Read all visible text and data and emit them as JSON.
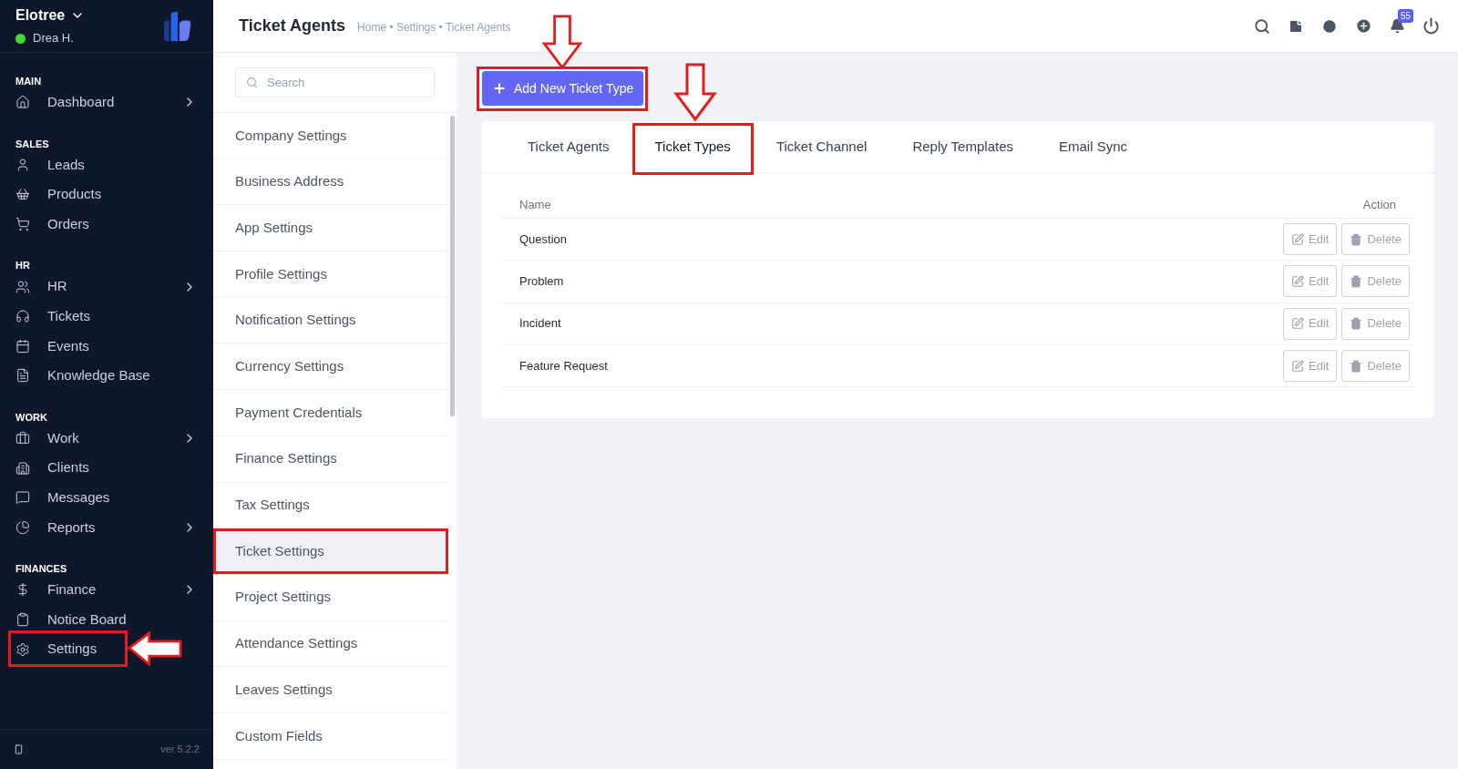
{
  "sidebar": {
    "workspace": "Elotree",
    "user": {
      "name": "Drea H.",
      "online": true
    },
    "sections": [
      {
        "title": "MAIN",
        "items": [
          {
            "label": "Dashboard",
            "expandable": true,
            "highlighted": false
          }
        ]
      },
      {
        "title": "SALES",
        "items": [
          {
            "label": "Leads",
            "expandable": false,
            "highlighted": false
          },
          {
            "label": "Products",
            "expandable": false,
            "highlighted": false
          },
          {
            "label": "Orders",
            "expandable": false,
            "highlighted": false
          }
        ]
      },
      {
        "title": "HR",
        "items": [
          {
            "label": "HR",
            "expandable": true,
            "highlighted": false
          },
          {
            "label": "Tickets",
            "expandable": false,
            "highlighted": false
          },
          {
            "label": "Events",
            "expandable": false,
            "highlighted": false
          },
          {
            "label": "Knowledge Base",
            "expandable": false,
            "highlighted": false
          }
        ]
      },
      {
        "title": "WORK",
        "items": [
          {
            "label": "Work",
            "expandable": true,
            "highlighted": false
          },
          {
            "label": "Clients",
            "expandable": false,
            "highlighted": false
          },
          {
            "label": "Messages",
            "expandable": false,
            "highlighted": false
          },
          {
            "label": "Reports",
            "expandable": true,
            "highlighted": false
          }
        ]
      },
      {
        "title": "FINANCES",
        "items": [
          {
            "label": "Finance",
            "expandable": true,
            "highlighted": false
          },
          {
            "label": "Notice Board",
            "expandable": false,
            "highlighted": false
          },
          {
            "label": "Settings",
            "expandable": false,
            "highlighted": true
          }
        ]
      }
    ],
    "version": "ver 5.2.2"
  },
  "header": {
    "title": "Ticket Agents",
    "breadcrumb": "Home • Settings • Ticket Agents",
    "notification_count": "55"
  },
  "settings_menu": {
    "search": {
      "placeholder": "Search"
    },
    "items": [
      {
        "label": "Company Settings",
        "selected": false,
        "highlighted": false
      },
      {
        "label": "Business Address",
        "selected": false,
        "highlighted": false
      },
      {
        "label": "App Settings",
        "selected": false,
        "highlighted": false
      },
      {
        "label": "Profile Settings",
        "selected": false,
        "highlighted": false
      },
      {
        "label": "Notification Settings",
        "selected": false,
        "highlighted": false
      },
      {
        "label": "Currency Settings",
        "selected": false,
        "highlighted": false
      },
      {
        "label": "Payment Credentials",
        "selected": false,
        "highlighted": false
      },
      {
        "label": "Finance Settings",
        "selected": false,
        "highlighted": false
      },
      {
        "label": "Tax Settings",
        "selected": false,
        "highlighted": false
      },
      {
        "label": "Ticket Settings",
        "selected": true,
        "highlighted": true
      },
      {
        "label": "Project Settings",
        "selected": false,
        "highlighted": false
      },
      {
        "label": "Attendance Settings",
        "selected": false,
        "highlighted": false
      },
      {
        "label": "Leaves Settings",
        "selected": false,
        "highlighted": false
      },
      {
        "label": "Custom Fields",
        "selected": false,
        "highlighted": false
      }
    ]
  },
  "add_button": {
    "label": "Add New Ticket Type",
    "highlighted": true
  },
  "tabs": [
    {
      "label": "Ticket Agents",
      "selected": false,
      "highlighted": false
    },
    {
      "label": "Ticket Types",
      "selected": true,
      "highlighted": true
    },
    {
      "label": "Ticket Channel",
      "selected": false,
      "highlighted": false
    },
    {
      "label": "Reply Templates",
      "selected": false,
      "highlighted": false
    },
    {
      "label": "Email Sync",
      "selected": false,
      "highlighted": false
    }
  ],
  "table": {
    "columns": [
      "Name",
      "Action"
    ],
    "rows": [
      {
        "name": "Question",
        "actions": [
          "Edit",
          "Delete"
        ]
      },
      {
        "name": "Problem",
        "actions": [
          "Edit",
          "Delete"
        ]
      },
      {
        "name": "Incident",
        "actions": [
          "Edit",
          "Delete"
        ]
      },
      {
        "name": "Feature Request",
        "actions": [
          "Edit",
          "Delete"
        ]
      }
    ]
  }
}
